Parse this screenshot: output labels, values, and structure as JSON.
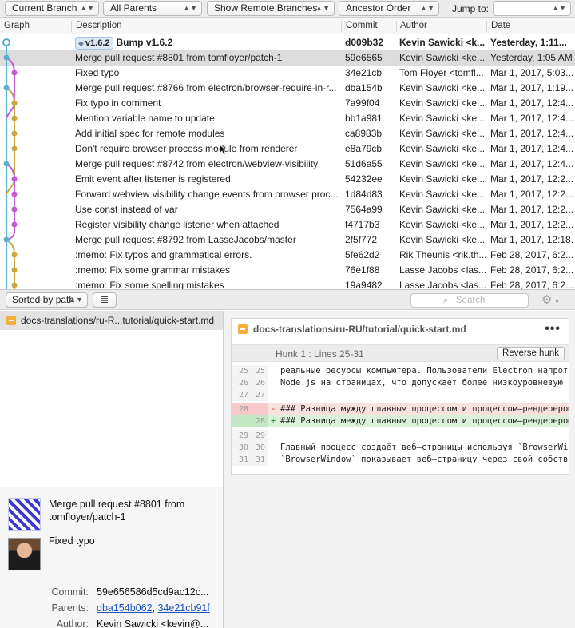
{
  "toolbar": {
    "branch_select": "Current Branch",
    "parents_select": "All Parents",
    "remote_select": "Show Remote Branches",
    "order_select": "Ancestor Order",
    "jump_label": "Jump to:"
  },
  "columns": {
    "graph": "Graph",
    "description": "Description",
    "commit": "Commit",
    "author": "Author",
    "date": "Date"
  },
  "commits": [
    {
      "tag": "v1.6.2",
      "description": "Bump v1.6.2",
      "commit": "d009b32",
      "author": "Kevin Sawicki <k...",
      "date": "Yesterday, 1:11..."
    },
    {
      "tag": "",
      "description": "Merge pull request #8801 from tomfloyer/patch-1",
      "commit": "59e6565",
      "author": "Kevin Sawicki <ke...",
      "date": "Yesterday, 1:05 AM"
    },
    {
      "tag": "",
      "description": "Fixed typo",
      "commit": "34e21cb",
      "author": "Tom Floyer <tomfl...",
      "date": "Mar 1, 2017, 5:03..."
    },
    {
      "tag": "",
      "description": "Merge pull request #8766 from electron/browser-require-in-r...",
      "commit": "dba154b",
      "author": "Kevin Sawicki <ke...",
      "date": "Mar 1, 2017, 1:19..."
    },
    {
      "tag": "",
      "description": "Fix typo in comment",
      "commit": "7a99f04",
      "author": "Kevin Sawicki <ke...",
      "date": "Mar 1, 2017, 12:4..."
    },
    {
      "tag": "",
      "description": "Mention variable name to update",
      "commit": "bb1a981",
      "author": "Kevin Sawicki <ke...",
      "date": "Mar 1, 2017, 12:4..."
    },
    {
      "tag": "",
      "description": "Add initial spec for remote modules",
      "commit": "ca8983b",
      "author": "Kevin Sawicki <ke...",
      "date": "Mar 1, 2017, 12:4..."
    },
    {
      "tag": "",
      "description": "Don't require browser process module from renderer",
      "commit": "e8a79cb",
      "author": "Kevin Sawicki <ke...",
      "date": "Mar 1, 2017, 12:4..."
    },
    {
      "tag": "",
      "description": "Merge pull request #8742 from electron/webview-visibility",
      "commit": "51d6a55",
      "author": "Kevin Sawicki <ke...",
      "date": "Mar 1, 2017, 12:4..."
    },
    {
      "tag": "",
      "description": "Emit event after listener is registered",
      "commit": "54232ee",
      "author": "Kevin Sawicki <ke...",
      "date": "Mar 1, 2017, 12:2..."
    },
    {
      "tag": "",
      "description": "Forward webview visibility change events from browser proc...",
      "commit": "1d84d83",
      "author": "Kevin Sawicki <ke...",
      "date": "Mar 1, 2017, 12:2..."
    },
    {
      "tag": "",
      "description": "Use const instead of var",
      "commit": "7564a99",
      "author": "Kevin Sawicki <ke...",
      "date": "Mar 1, 2017, 12:2..."
    },
    {
      "tag": "",
      "description": "Register visibility change listener when attached",
      "commit": "f4717b3",
      "author": "Kevin Sawicki <ke...",
      "date": "Mar 1, 2017, 12:2..."
    },
    {
      "tag": "",
      "description": "Merge pull request #8792 from LasseJacobs/master",
      "commit": "2f5f772",
      "author": "Kevin Sawicki <ke...",
      "date": "Mar 1, 2017, 12:18..."
    },
    {
      "tag": "",
      "description": ":memo: Fix typos and grammatical errors.",
      "commit": "5fe62d2",
      "author": "Rik Theunis <rik.th...",
      "date": "Feb 28, 2017, 6:2..."
    },
    {
      "tag": "",
      "description": ":memo: Fix some grammar mistakes",
      "commit": "76e1f88",
      "author": "Lasse Jacobs <las...",
      "date": "Feb 28, 2017, 6:2..."
    },
    {
      "tag": "",
      "description": ":memo: Fix some spelling mistakes",
      "commit": "19a9482",
      "author": "Lasse Jacobs <las...",
      "date": "Feb 28, 2017, 6:2..."
    }
  ],
  "midbar": {
    "sort_label": "Sorted by path",
    "list_icon": "≣",
    "search_placeholder": "Search",
    "gear_icon": "⚙"
  },
  "left_pane": {
    "file_path": "docs-translations/ru-R...tutorial/quick-start.md",
    "commit_message": "Merge pull request #8801 from tomfloyer/patch-1",
    "second_message": "Fixed typo",
    "commit_label": "Commit:",
    "commit_value": "59e656586d5cd9ac12c...",
    "parents_label": "Parents:",
    "parent_1": "dba154b062",
    "parent_sep": ", ",
    "parent_2": "34e21cb91f",
    "author_label": "Author:",
    "author_value": "Kevin Sawicki <kevin@..."
  },
  "diff": {
    "file_path": "docs-translations/ru-RU/tutorial/quick-start.md",
    "more_icon": "•••",
    "hunk_title": "Hunk 1 : Lines 25-31",
    "reverse_label": "Reverse hunk",
    "lines": [
      {
        "type": "ctx",
        "old": "25",
        "new": "25",
        "sign": "",
        "text": "реальные ресурсы компьютера. Пользователи Electron напротив"
      },
      {
        "type": "ctx",
        "old": "26",
        "new": "26",
        "sign": "",
        "text": "Node.js на страницах, что допускает более низкоуровневую раб"
      },
      {
        "type": "ctx",
        "old": "27",
        "new": "27",
        "sign": "",
        "text": ""
      },
      {
        "type": "del",
        "old": "28",
        "new": "",
        "sign": "-",
        "text": "### Разница мужду главным процессом и процессом–рендерером"
      },
      {
        "type": "add",
        "old": "",
        "new": "28",
        "sign": "+",
        "text": "### Разница между главным процессом и процессом–рендерером"
      },
      {
        "type": "ctx",
        "old": "29",
        "new": "29",
        "sign": "",
        "text": ""
      },
      {
        "type": "ctx",
        "old": "30",
        "new": "30",
        "sign": "",
        "text": "Главный процесс создаёт веб–страницы используя `BrowserWindo"
      },
      {
        "type": "ctx",
        "old": "31",
        "new": "31",
        "sign": "",
        "text": "`BrowserWindow` показывает веб–страницу через свой собственн"
      }
    ]
  },
  "colors": {
    "graph_blue": "#5aaed2",
    "graph_pink": "#c45ad6",
    "graph_gold": "#c9a844",
    "selection": "#dcdcdc",
    "link": "#1a52c6"
  }
}
